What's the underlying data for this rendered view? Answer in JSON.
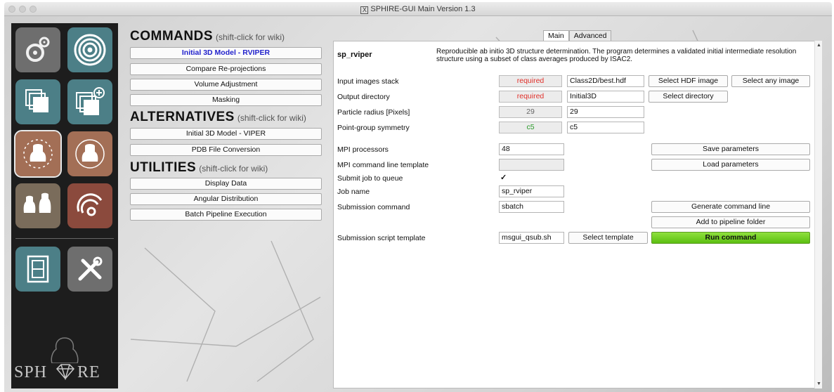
{
  "window": {
    "title": "SPHIRE-GUI Main Version 1.3"
  },
  "sidebar": {
    "tiles": [
      {
        "name": "utilities-gears-icon",
        "color": "#6e6e6e"
      },
      {
        "name": "target-rings-icon",
        "color": "#4c7f87"
      },
      {
        "name": "stack-images-icon",
        "color": "#4c7f87"
      },
      {
        "name": "add-stack-icon",
        "color": "#4c7f87"
      },
      {
        "name": "bust-3d-icon",
        "color": "#a36f56"
      },
      {
        "name": "bust-rotate-icon",
        "color": "#a36f56"
      },
      {
        "name": "two-busts-icon",
        "color": "#7a6c5b"
      },
      {
        "name": "signal-waves-icon",
        "color": "#8b4a3d"
      },
      {
        "name": "film-strip-icon",
        "color": "#4c7f87"
      },
      {
        "name": "tools-icon",
        "color": "#6e6e6e"
      }
    ],
    "logo_text_left": "SPH",
    "logo_text_right": "RE"
  },
  "commands": {
    "heading": "COMMANDS",
    "hint": "(shift-click for wiki)",
    "items": [
      "Initial 3D Model - RVIPER",
      "Compare Re-projections",
      "Volume Adjustment",
      "Masking"
    ]
  },
  "alternatives": {
    "heading": "ALTERNATIVES",
    "hint": "(shift-click for wiki)",
    "items": [
      "Initial 3D Model - VIPER",
      "PDB File Conversion"
    ]
  },
  "utilities": {
    "heading": "UTILITIES",
    "hint": "(shift-click for wiki)",
    "items": [
      "Display Data",
      "Angular Distribution",
      "Batch Pipeline Execution"
    ]
  },
  "tabs": [
    "Main",
    "Advanced"
  ],
  "program": {
    "name": "sp_rviper",
    "description": "Reproducible ab initio 3D structure determination. The program determines a validated initial intermediate resolution structure using a subset of class averages produced by ISAC2."
  },
  "params": {
    "input_stack": {
      "label": "Input images stack",
      "default": "required",
      "value": "Class2D/best.hdf",
      "btn1": "Select HDF image",
      "btn2": "Select any image"
    },
    "output_dir": {
      "label": "Output directory",
      "default": "required",
      "value": "Initial3D",
      "btn1": "Select directory"
    },
    "radius": {
      "label": "Particle radius [Pixels]",
      "default": "29",
      "value": "29"
    },
    "symmetry": {
      "label": "Point-group symmetry",
      "default": "c5",
      "value": "c5"
    }
  },
  "mpi": {
    "processors_label": "MPI processors",
    "processors_value": "48",
    "template_label": "MPI command line template",
    "template_value": "",
    "queue_label": "Submit job to queue",
    "queue_check": "✓",
    "jobname_label": "Job name",
    "jobname_value": "sp_rviper",
    "subcmd_label": "Submission command",
    "subcmd_value": "sbatch",
    "script_label": "Submission script template",
    "script_value": "msgui_qsub.sh",
    "select_template": "Select template"
  },
  "actions": {
    "save": "Save parameters",
    "load": "Load parameters",
    "generate": "Generate command line",
    "pipeline": "Add to pipeline folder",
    "run": "Run command"
  }
}
